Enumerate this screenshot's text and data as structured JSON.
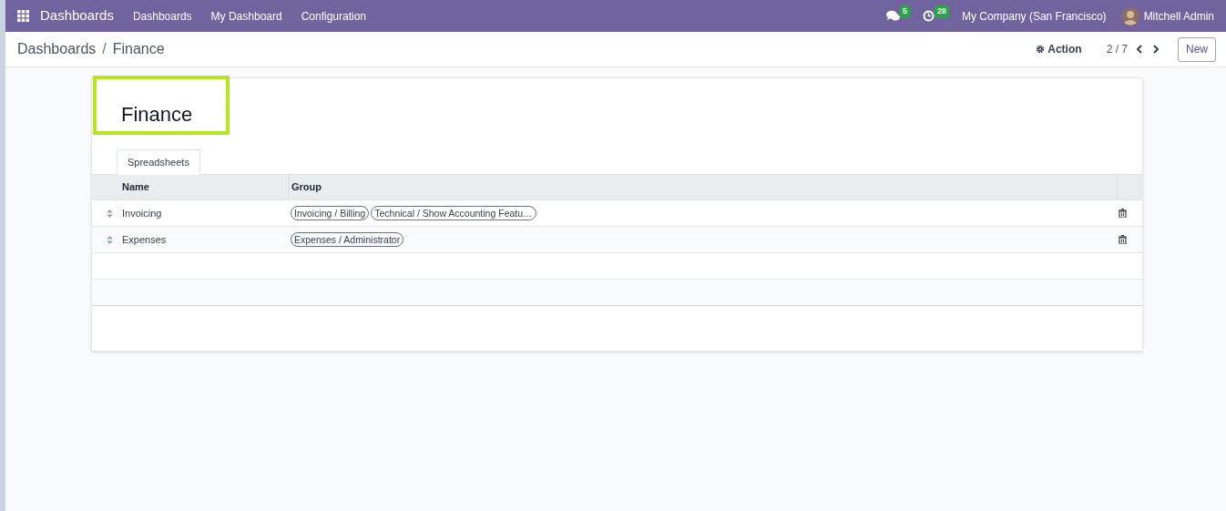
{
  "navbar": {
    "app_title": "Dashboards",
    "menu": [
      "Dashboards",
      "My Dashboard",
      "Configuration"
    ],
    "messages_count": "5",
    "activities_count": "28",
    "company": "My Company (San Francisco)",
    "user": "Mitchell Admin"
  },
  "control_panel": {
    "breadcrumb": [
      "Dashboards",
      "Finance"
    ],
    "breadcrumb_separator": "/",
    "action": "Action",
    "pager": "2 / 7",
    "new_button": "New"
  },
  "form": {
    "title": "Finance",
    "tabs": [
      {
        "label": "Spreadsheets",
        "selected": true
      }
    ],
    "table": {
      "columns": [
        "Name",
        "Group"
      ],
      "rows": [
        {
          "name": "Invoicing",
          "groups": [
            "Invoicing / Billing",
            "Technical / Show Accounting Featu…"
          ]
        },
        {
          "name": "Expenses",
          "groups": [
            "Expenses / Administrator"
          ]
        }
      ]
    }
  }
}
